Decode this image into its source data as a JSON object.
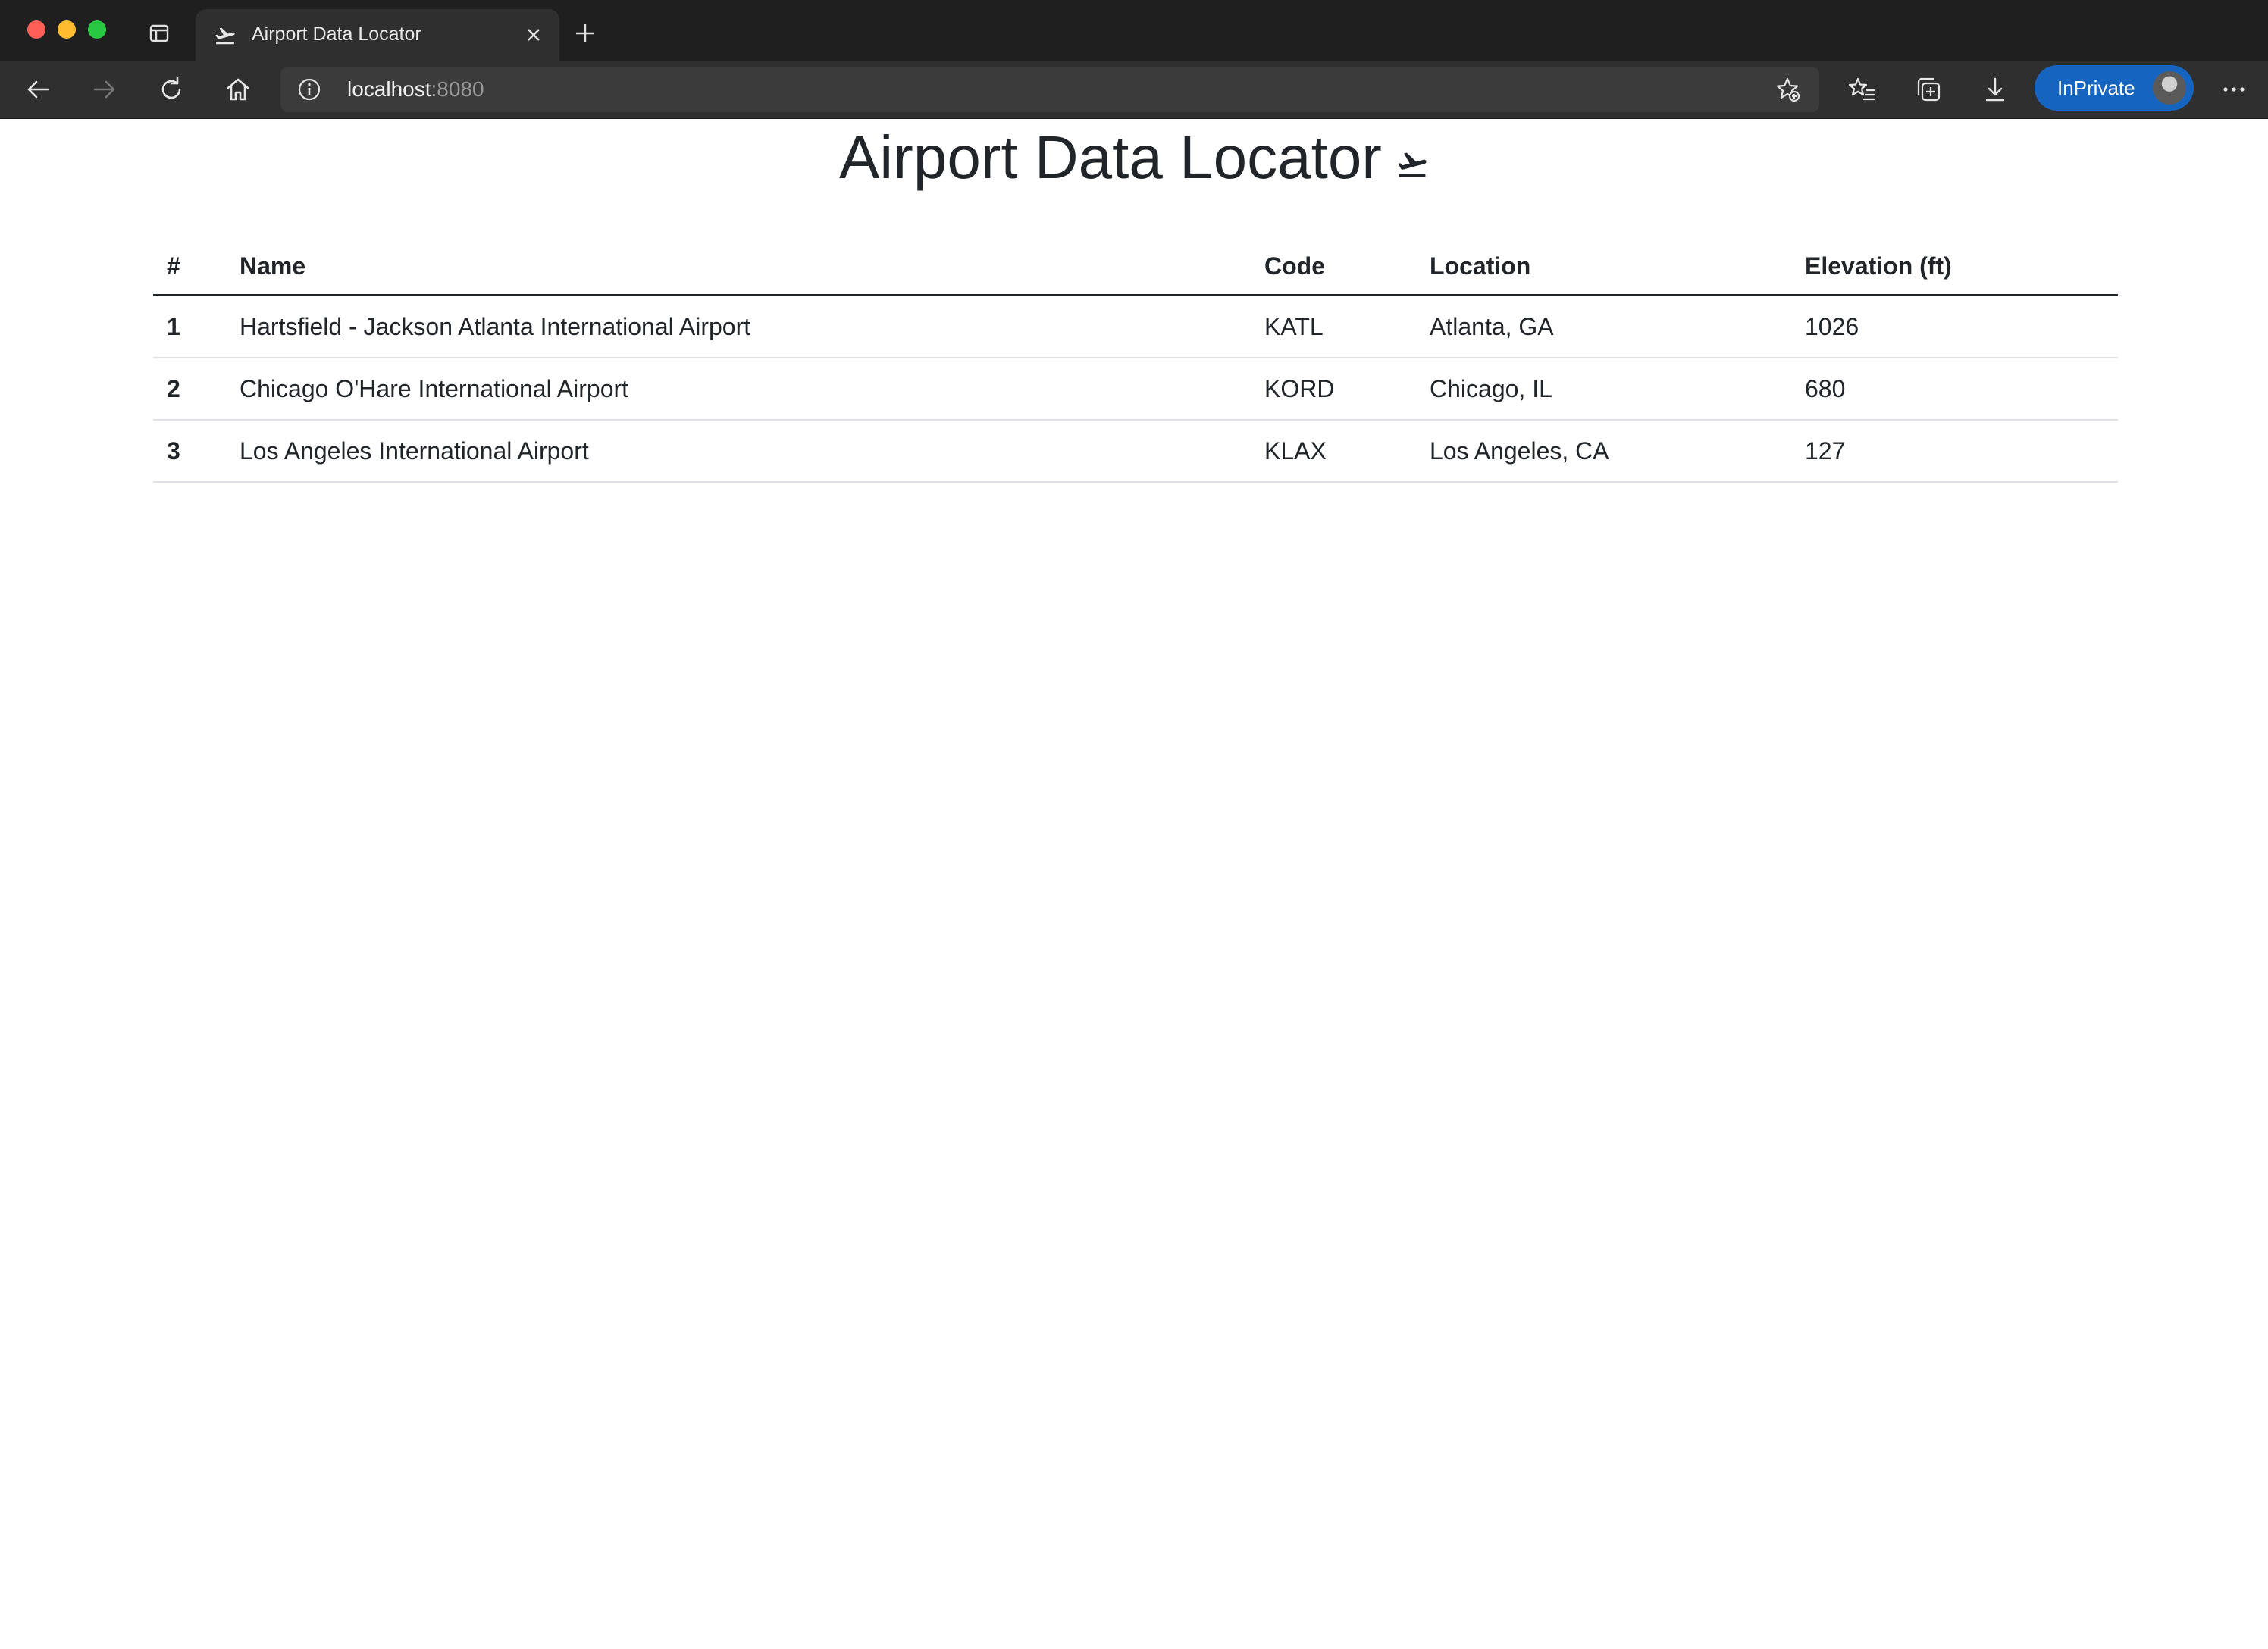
{
  "browser": {
    "tab": {
      "title": "Airport Data Locator",
      "icon": "airplane-takeoff-icon"
    },
    "address": {
      "host": "localhost",
      "port": ":8080"
    },
    "inprivate_label": "InPrivate"
  },
  "page": {
    "title": "Airport Data Locator",
    "title_icon": "airplane-takeoff-icon"
  },
  "table": {
    "headers": [
      "#",
      "Name",
      "Code",
      "Location",
      "Elevation (ft)"
    ],
    "rows": [
      {
        "index": "1",
        "name": "Hartsfield - Jackson Atlanta International Airport",
        "code": "KATL",
        "location": "Atlanta, GA",
        "elevation": "1026"
      },
      {
        "index": "2",
        "name": "Chicago O'Hare International Airport",
        "code": "KORD",
        "location": "Chicago, IL",
        "elevation": "680"
      },
      {
        "index": "3",
        "name": "Los Angeles International Airport",
        "code": "KLAX",
        "location": "Los Angeles, CA",
        "elevation": "127"
      }
    ]
  }
}
